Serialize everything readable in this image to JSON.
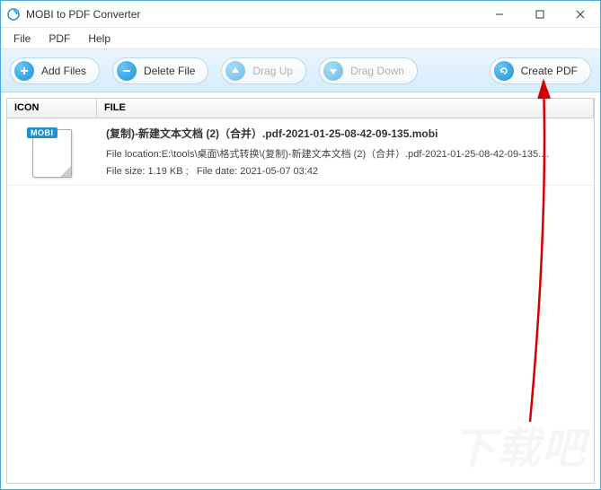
{
  "window": {
    "title": "MOBI to PDF Converter"
  },
  "menu": {
    "file": "File",
    "pdf": "PDF",
    "help": "Help"
  },
  "toolbar": {
    "add_files": "Add Files",
    "delete_file": "Delete File",
    "drag_up": "Drag Up",
    "drag_down": "Drag Down",
    "create_pdf": "Create PDF"
  },
  "columns": {
    "icon": "ICON",
    "file": "FILE"
  },
  "files": [
    {
      "badge": "MOBI",
      "name": "(复制)-新建文本文档 (2)（合并）.pdf-2021-01-25-08-42-09-135.mobi",
      "location_label": "File location:",
      "location": "E:\\tools\\桌面\\格式转换\\(复制)-新建文本文档 (2)（合并）.pdf-2021-01-25-08-42-09-135....",
      "size_label": "File size:",
      "size": "1.19 KB",
      "date_label": "File date:",
      "date": "2021-05-07 03:42"
    }
  ],
  "watermark": "下载吧"
}
